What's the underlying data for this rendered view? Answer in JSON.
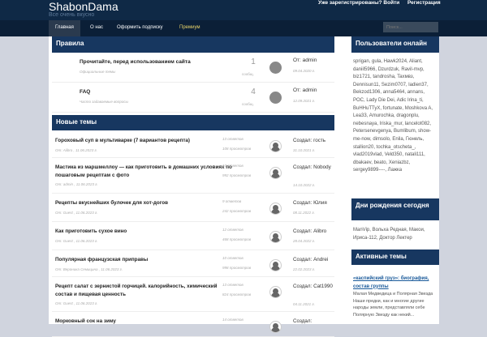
{
  "header": {
    "logo": "ShabonDama",
    "slogan": "Все очень вкусно",
    "login": "Уже зарегистрированы? Войти",
    "register": "Регистрация"
  },
  "nav": {
    "items": [
      "Главная",
      "О нас",
      "Оформить подписку",
      "Премиум"
    ],
    "search_placeholder": "Поиск..."
  },
  "rules": {
    "title": "Правила",
    "items": [
      {
        "title": "Прочитайте, перед использованием сайта",
        "subtitle": "Официальные темы",
        "count": "1",
        "count_label": "сообщ.",
        "author": "От: admin",
        "date": "09.04.2020 г."
      },
      {
        "title": "FAQ",
        "subtitle": "Часто задаваемые вопросы",
        "count": "4",
        "count_label": "сообщ.",
        "author": "От: admin",
        "date": "12.09.2021 г."
      }
    ]
  },
  "new_topics": {
    "title": "Новые темы",
    "items": [
      {
        "title": "Гороховый суп в мультиварке (7 вариантов рецепта)",
        "meta": "От: Alibro , 11.06.2023 г.",
        "replies": "13 ответов",
        "views": "108 просмотров",
        "creator": "Создал: гость",
        "date": "31.10.2021 г."
      },
      {
        "title": "Мастика из маршмеллоу — как приготовить в домашних условиях по пошаговым рецептам с фото",
        "meta": "От: admin , 11.06.2023 г.",
        "replies": "13 ответов",
        "views": "992 просмотров",
        "creator": "Создал: Nobody",
        "date": "14.10.2022 г."
      },
      {
        "title": "Рецепты вкуснейших булочек для хот-догов",
        "meta": "От: Guest , 11.06.2023 г.",
        "replies": "9 ответов",
        "views": "242 просмотров",
        "creator": "Создал: Юлия",
        "date": "08.11.2022 г."
      },
      {
        "title": "Как приготовить сухое вино",
        "meta": "От: Guest , 11.06.2023 г.",
        "replies": "12 ответов",
        "views": "468 просмотров",
        "creator": "Создал: Alibro",
        "date": "28.04.2022 г."
      },
      {
        "title": "Популярная французская приправы",
        "meta": "От: Вероника Семицина , 11.06.2023 г.",
        "replies": "10 ответов",
        "views": "998 просмотров",
        "creator": "Создал: Andrei",
        "date": "22.02.2023 г."
      },
      {
        "title": "Рецепт салат с зернистой горчицей. калорийность, химический состав и пищевая ценность",
        "meta": "От: Guest , 11.06.2023 г.",
        "replies": "13 ответов",
        "views": "824 просмотров",
        "creator": "Создал: Cat1990",
        "date": "04.11.2021 г."
      },
      {
        "title": "Морковный сок на зиму",
        "meta": "",
        "replies": "14 ответов",
        "views": "",
        "creator": "Создал:",
        "date": ""
      }
    ]
  },
  "sidebar": {
    "online_title": "Пользователи онлайн",
    "online_users": "sprigan, gula, Hawk2024, Aliant, daniil5966, Dzurdzuk, Ravil-mvp, biz1721, tandrosha, Taxмвз, Dennisun11, Sezim0707, ladien37, Bekzod1306, anna5464, annans, POC, Lady Die Dei, Adic Irina_ti, BuHHuTTyX, fortunate, Moshkova A, Lea33, Amurochka, dragonplu, nebesnaya, Iriska_mur, lancelot082, Petersenevgenya, Bumlibum, show-me-now, dimsolo, Enila, Гюнель, stallion20, tochka_otscheta_, vlad2019vlad, Veld350, natali111, dbakaev, beato, Xeniazbz, sergey9899----, Лажка",
    "birthday_title": "Дни рождения сегодня",
    "birthday_users": "ManVip, Вольха Редная, Макои, Ириса-112, Доктор Лектер",
    "active_title": "Активные темы",
    "active_link": "«каспийский груз»: биография, состав группы",
    "active_text": "Малая Медведица и Полярная Звезда Наши предки, как и многие другие народы земли, представляли себе Полярную Звезду как некий..."
  }
}
